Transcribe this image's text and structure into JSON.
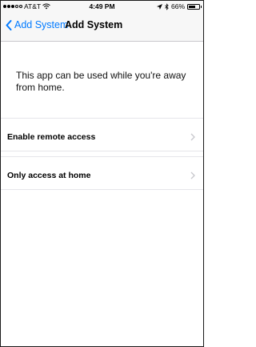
{
  "status_bar": {
    "carrier": "AT&T",
    "time": "4:49 PM",
    "battery": "66%",
    "battery_level": 0.66,
    "signal_strength": "3 of 5",
    "icons": [
      "signal-dots-icon",
      "wifi-icon",
      "location-arrow-icon",
      "bluetooth-icon",
      "battery-icon"
    ]
  },
  "nav": {
    "back_label": "Add System",
    "title": "Add System"
  },
  "main": {
    "message": "This app can be used while you're away from home.",
    "options": [
      {
        "label": "Enable remote access",
        "icon": "chevron-right-icon"
      },
      {
        "label": "Only access at home",
        "icon": "chevron-right-icon"
      }
    ]
  },
  "colors": {
    "accent": "#007aff",
    "background": "#ffffff",
    "bar_background": "#f7f7f7",
    "separator": "#e6e6ea",
    "chevron": "#c7c7cc"
  }
}
